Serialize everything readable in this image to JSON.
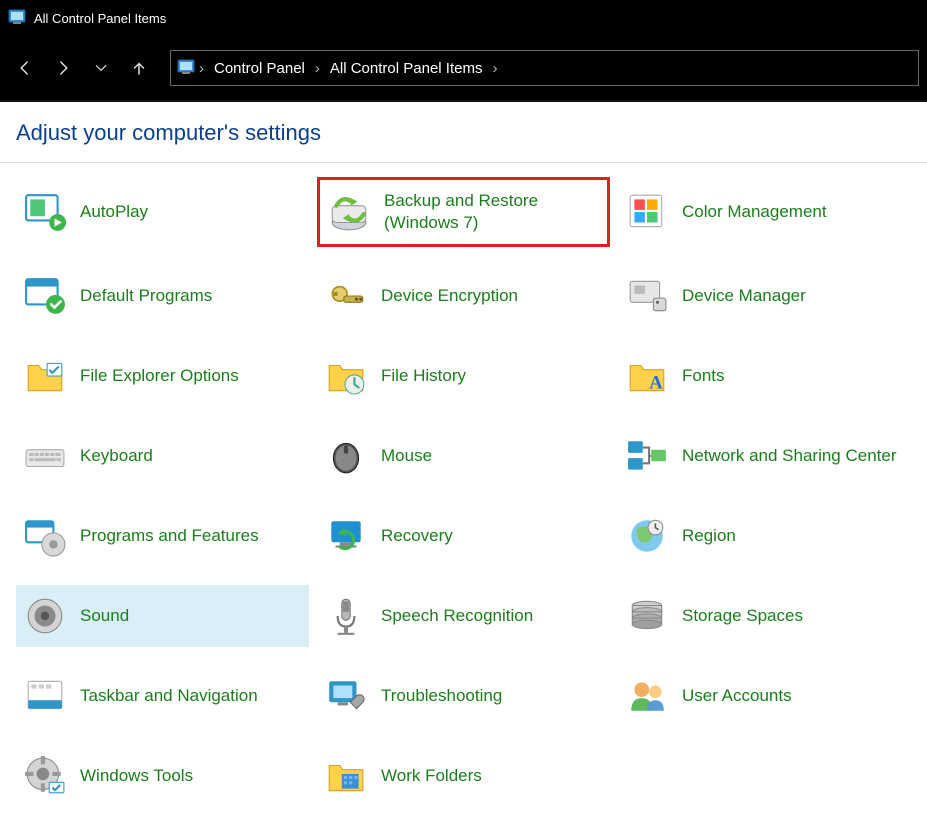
{
  "window": {
    "title": "All Control Panel Items"
  },
  "breadcrumb": [
    {
      "label": "Control Panel"
    },
    {
      "label": "All Control Panel Items"
    }
  ],
  "heading": "Adjust your computer's settings",
  "items": [
    {
      "id": "autoplay",
      "label": "AutoPlay",
      "icon": "autoplay"
    },
    {
      "id": "backup",
      "label": "Backup and Restore (Windows 7)",
      "icon": "backup",
      "highlighted": true
    },
    {
      "id": "color",
      "label": "Color Management",
      "icon": "color"
    },
    {
      "id": "defaultprogs",
      "label": "Default Programs",
      "icon": "defaultprogs"
    },
    {
      "id": "devenc",
      "label": "Device Encryption",
      "icon": "devenc"
    },
    {
      "id": "devmgr",
      "label": "Device Manager",
      "icon": "devmgr"
    },
    {
      "id": "fileexp",
      "label": "File Explorer Options",
      "icon": "fileexp"
    },
    {
      "id": "filehist",
      "label": "File History",
      "icon": "filehist"
    },
    {
      "id": "fonts",
      "label": "Fonts",
      "icon": "fonts"
    },
    {
      "id": "keyboard",
      "label": "Keyboard",
      "icon": "keyboard"
    },
    {
      "id": "mouse",
      "label": "Mouse",
      "icon": "mouse"
    },
    {
      "id": "network",
      "label": "Network and Sharing Center",
      "icon": "network"
    },
    {
      "id": "progfeat",
      "label": "Programs and Features",
      "icon": "progfeat"
    },
    {
      "id": "recovery",
      "label": "Recovery",
      "icon": "recovery"
    },
    {
      "id": "region",
      "label": "Region",
      "icon": "region"
    },
    {
      "id": "sound",
      "label": "Sound",
      "icon": "sound",
      "selected": true
    },
    {
      "id": "speech",
      "label": "Speech Recognition",
      "icon": "speech"
    },
    {
      "id": "storage",
      "label": "Storage Spaces",
      "icon": "storage"
    },
    {
      "id": "taskbar",
      "label": "Taskbar and Navigation",
      "icon": "taskbar"
    },
    {
      "id": "trouble",
      "label": "Troubleshooting",
      "icon": "trouble"
    },
    {
      "id": "users",
      "label": "User Accounts",
      "icon": "users"
    },
    {
      "id": "wintools",
      "label": "Windows Tools",
      "icon": "wintools"
    },
    {
      "id": "workfold",
      "label": "Work Folders",
      "icon": "workfold"
    }
  ]
}
